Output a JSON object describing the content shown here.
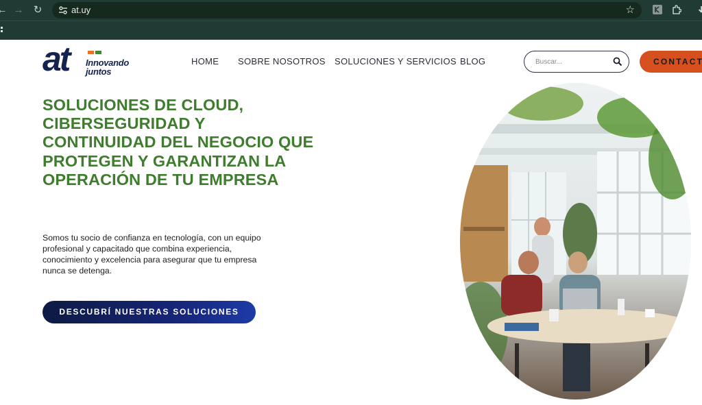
{
  "browser": {
    "url": "at.uy",
    "back_glyph": "←",
    "forward_glyph": "→",
    "reload_glyph": "↻",
    "star_glyph": "☆"
  },
  "logo": {
    "text": "at",
    "tagline_line1": "Innovando",
    "tagline_line2": "juntos",
    "bar_colors": [
      "#e8742a",
      "#3f8a2e"
    ]
  },
  "nav": {
    "items": [
      {
        "label": "HOME"
      },
      {
        "label": "SOBRE NOSOTROS"
      },
      {
        "label": "SOLUCIONES Y SERVICIOS"
      },
      {
        "label": "BLOG"
      }
    ]
  },
  "search": {
    "placeholder": "Buscar...",
    "value": ""
  },
  "contact": {
    "label": "CONTACTO"
  },
  "hero": {
    "title": "SOLUCIONES DE CLOUD, CIBERSEGURIDAD Y CONTINUIDAD DEL NEGOCIO QUE PROTEGEN Y GARANTIZAN LA OPERACIÓN DE TU EMPRESA",
    "description": "Somos tu socio de confianza en tecnología, con un equipo profesional y capacitado que combina experiencia, conocimiento y excelencia para asegurar que tu empresa nunca se detenga.",
    "cta_label": "DESCUBRÍ NUESTRAS SOLUCIONES"
  },
  "colors": {
    "chrome_bg": "#1f3b33",
    "title_green": "#3f7d2e",
    "logo_navy": "#14224f",
    "contact_orange": "#d6501f",
    "cta_navy": "#0d1a43"
  },
  "icons": {
    "site_info": "tune-icon",
    "search": "search-icon",
    "bookmark_star": "star-icon",
    "extensions": "puzzle-icon"
  }
}
